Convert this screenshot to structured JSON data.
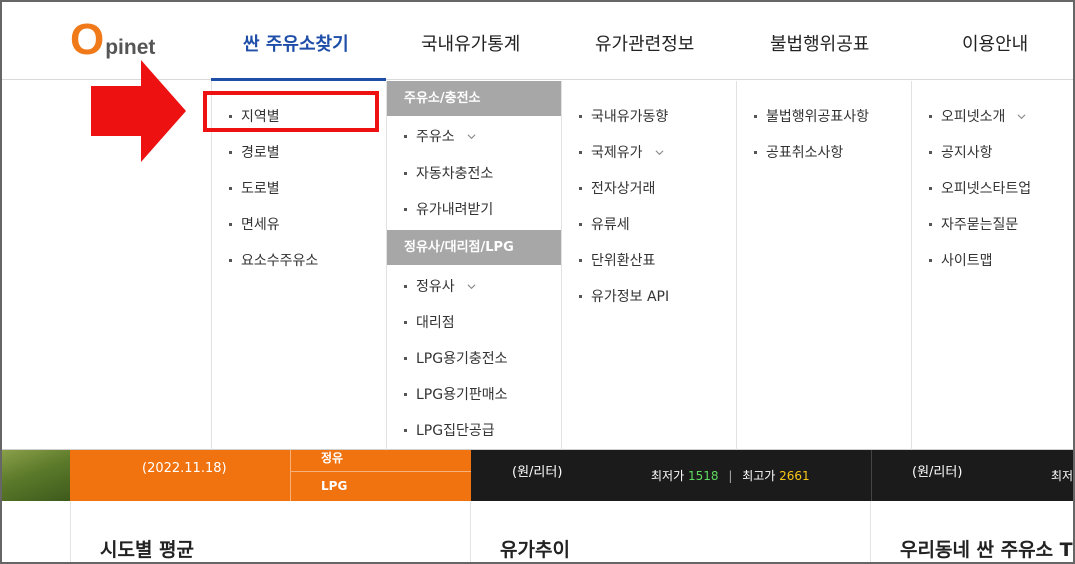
{
  "logo": {
    "o": "O",
    "rest": "pinet"
  },
  "nav": [
    "싼 주유소찾기",
    "국내유가통계",
    "유가관련정보",
    "불법행위공표",
    "이용안내"
  ],
  "menu": {
    "col1": [
      "지역별",
      "경로별",
      "도로별",
      "면세유",
      "요소수주유소"
    ],
    "col2": {
      "group1_title": "주유소/충전소",
      "group1_items": [
        "주유소",
        "자동차충전소",
        "유가내려받기"
      ],
      "group2_title": "정유사/대리점/LPG",
      "group2_items": [
        "정유사",
        "대리점",
        "LPG용기충전소",
        "LPG용기판매소",
        "LPG집단공급"
      ]
    },
    "col3": [
      "국내유가동향",
      "국제유가",
      "전자상거래",
      "유류세",
      "단위환산표",
      "유가정보 API"
    ],
    "col4": [
      "불법행위공표사항",
      "공표취소사항"
    ],
    "col5": [
      "오피넷소개",
      "공지사항",
      "오피넷스타트업",
      "자주묻는질문",
      "사이트맵"
    ]
  },
  "strip": {
    "date": "(2022.11.18)",
    "tab_jeongyu": "정유",
    "tab_lpg": "LPG",
    "unit1": "(원/리터)",
    "low_label": "최저가",
    "low_value": "1518",
    "high_label": "최고가",
    "high_value": "2661",
    "unit2": "(원/리터)",
    "low_label_2": "최저"
  },
  "sections": [
    "시도별 평균",
    "유가추이",
    "우리동네 싼 주유소 T"
  ],
  "colors": {
    "accent_blue": "#1e4ea8",
    "brand_orange": "#f07310",
    "highlight_red": "#ee1111",
    "low_green": "#5ed85e",
    "high_yellow": "#f5c518"
  }
}
